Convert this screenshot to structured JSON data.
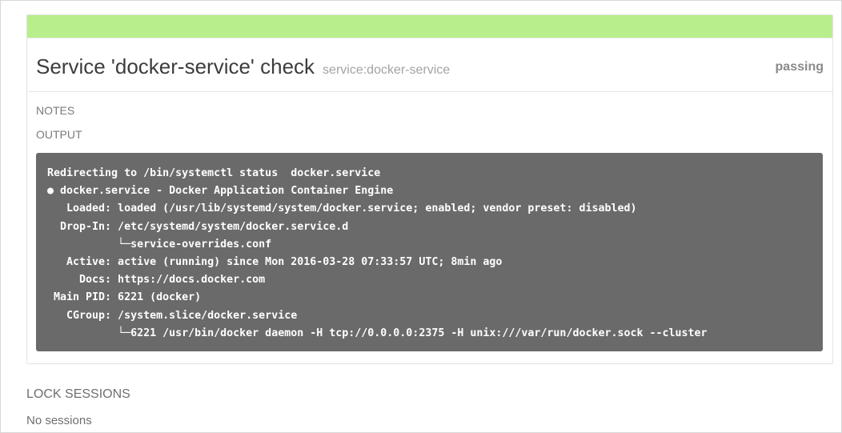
{
  "check": {
    "title": "Service 'docker-service' check",
    "subtitle": "service:docker-service",
    "status": "passing",
    "status_color": "#b8ee8b"
  },
  "sections": {
    "notes_label": "NOTES",
    "output_label": "OUTPUT"
  },
  "output": {
    "lines": [
      "Redirecting to /bin/systemctl status  docker.service",
      "● docker.service - Docker Application Container Engine",
      "   Loaded: loaded (/usr/lib/systemd/system/docker.service; enabled; vendor preset: disabled)",
      "  Drop-In: /etc/systemd/system/docker.service.d",
      "           └─service-overrides.conf",
      "   Active: active (running) since Mon 2016-03-28 07:33:57 UTC; 8min ago",
      "     Docs: https://docs.docker.com",
      " Main PID: 6221 (docker)",
      "   CGroup: /system.slice/docker.service",
      "           └─6221 /usr/bin/docker daemon -H tcp://0.0.0.0:2375 -H unix:///var/run/docker.sock --cluster"
    ]
  },
  "lock_sessions": {
    "label": "LOCK SESSIONS",
    "empty_text": "No sessions"
  }
}
